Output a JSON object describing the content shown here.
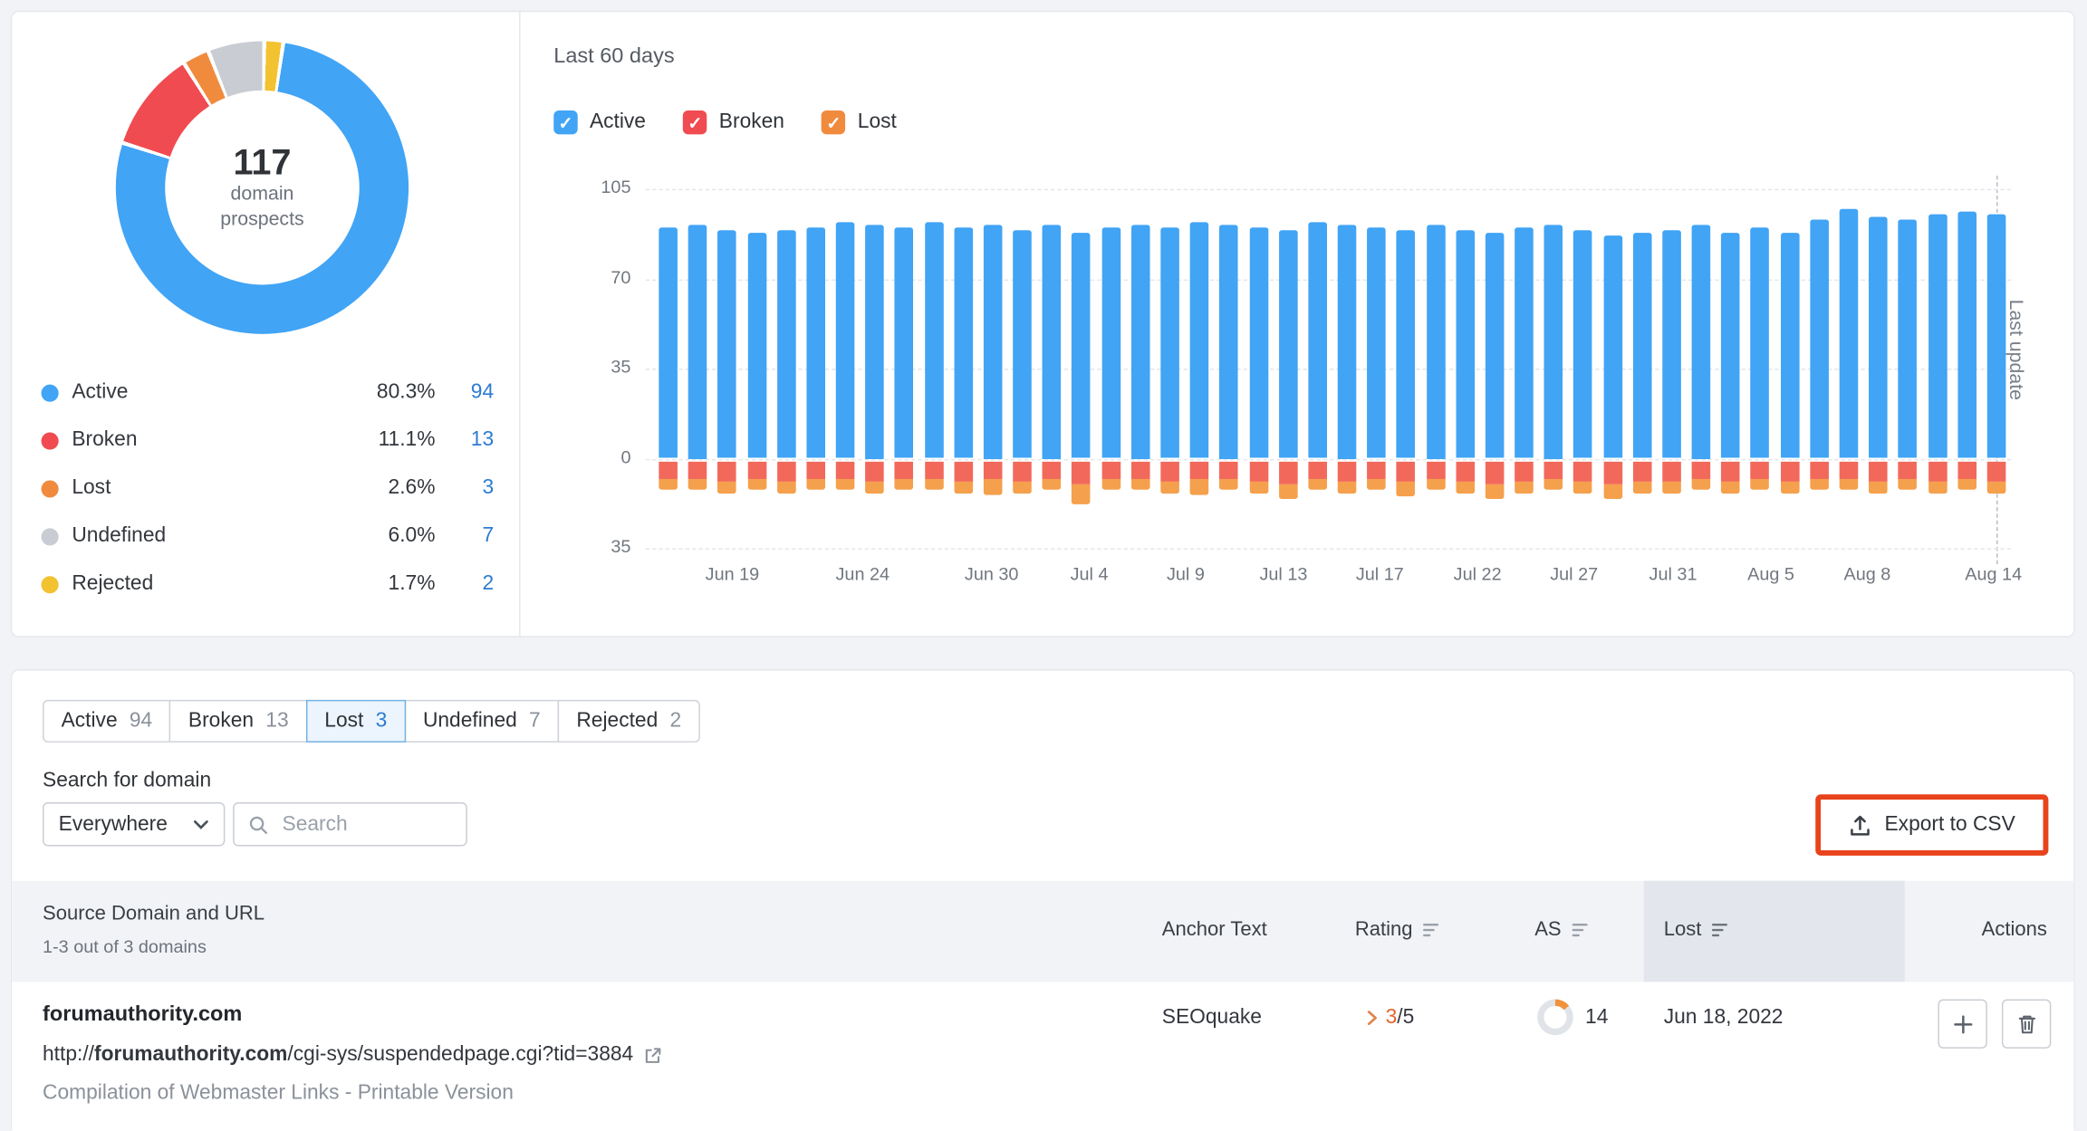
{
  "donut": {
    "center_value": "117",
    "center_line1": "domain",
    "center_line2": "prospects",
    "legend": [
      {
        "label": "Active",
        "percent": "80.3%",
        "count": "94",
        "color": "#41a4f5"
      },
      {
        "label": "Broken",
        "percent": "11.1%",
        "count": "13",
        "color": "#f04b50"
      },
      {
        "label": "Lost",
        "percent": "2.6%",
        "count": "3",
        "color": "#f08b3e"
      },
      {
        "label": "Undefined",
        "percent": "6.0%",
        "count": "7",
        "color": "#c9ccd2"
      },
      {
        "label": "Rejected",
        "percent": "1.7%",
        "count": "2",
        "color": "#f2c230"
      }
    ]
  },
  "timeline": {
    "title": "Last 60 days",
    "filters": [
      {
        "label": "Active",
        "color": "#41a4f5"
      },
      {
        "label": "Broken",
        "color": "#f04b50"
      },
      {
        "label": "Lost",
        "color": "#f08b3e"
      }
    ],
    "last_update_label": "Last update"
  },
  "chart_data": {
    "type": "bar",
    "stacked": true,
    "title": "Last 60 days",
    "ylim": [
      -35,
      105
    ],
    "grid": true,
    "yticks": [
      {
        "value": 105,
        "label": "105"
      },
      {
        "value": 70,
        "label": "70"
      },
      {
        "value": 35,
        "label": "35"
      },
      {
        "value": 0,
        "label": "0"
      },
      {
        "value": -35,
        "label": "35"
      }
    ],
    "series": [
      {
        "name": "Active",
        "color": "#41a4f5",
        "direction": "positive",
        "values": [
          90,
          91,
          89,
          88,
          89,
          90,
          92,
          91,
          90,
          92,
          90,
          91,
          89,
          91,
          88,
          90,
          91,
          90,
          92,
          91,
          90,
          89,
          92,
          91,
          90,
          89,
          91,
          89,
          88,
          90,
          91,
          89,
          87,
          88,
          89,
          91,
          88,
          90,
          88,
          93,
          97,
          94,
          93,
          95,
          96,
          95
        ]
      },
      {
        "name": "Broken",
        "color": "#f2695c",
        "direction": "negative",
        "values": [
          7,
          7,
          8,
          7,
          8,
          7,
          7,
          8,
          7,
          7,
          8,
          7,
          8,
          7,
          9,
          7,
          7,
          8,
          7,
          7,
          8,
          9,
          7,
          8,
          7,
          8,
          7,
          8,
          9,
          8,
          7,
          8,
          9,
          8,
          8,
          7,
          8,
          7,
          8,
          7,
          7,
          8,
          7,
          8,
          7,
          8
        ]
      },
      {
        "name": "Lost",
        "color": "#f5a04c",
        "direction": "negative",
        "values": [
          4,
          4,
          5,
          4,
          5,
          4,
          4,
          5,
          4,
          4,
          5,
          6,
          5,
          4,
          8,
          4,
          4,
          5,
          6,
          4,
          5,
          6,
          4,
          5,
          4,
          6,
          4,
          5,
          6,
          5,
          4,
          5,
          6,
          5,
          5,
          4,
          5,
          4,
          5,
          4,
          4,
          5,
          4,
          5,
          4,
          5
        ]
      }
    ],
    "x_ticks": [
      {
        "label": "Jun 19",
        "pos": 0.058
      },
      {
        "label": "Jun 24",
        "pos": 0.154
      },
      {
        "label": "Jun 30",
        "pos": 0.249
      },
      {
        "label": "Jul 4",
        "pos": 0.321
      },
      {
        "label": "Jul 9",
        "pos": 0.392
      },
      {
        "label": "Jul 13",
        "pos": 0.464
      },
      {
        "label": "Jul 17",
        "pos": 0.535
      },
      {
        "label": "Jul 22",
        "pos": 0.607
      },
      {
        "label": "Jul 27",
        "pos": 0.678
      },
      {
        "label": "Jul 31",
        "pos": 0.751
      },
      {
        "label": "Aug 5",
        "pos": 0.823
      },
      {
        "label": "Aug 8",
        "pos": 0.894
      },
      {
        "label": "Aug 14",
        "pos": 0.987
      }
    ],
    "last_update_index": 45
  },
  "tabs": [
    {
      "label": "Active",
      "count": "94",
      "selected": false
    },
    {
      "label": "Broken",
      "count": "13",
      "selected": false
    },
    {
      "label": "Lost",
      "count": "3",
      "selected": true
    },
    {
      "label": "Undefined",
      "count": "7",
      "selected": false
    },
    {
      "label": "Rejected",
      "count": "2",
      "selected": false
    }
  ],
  "search": {
    "label": "Search for domain",
    "scope": "Everywhere",
    "placeholder": "Search"
  },
  "export": {
    "label": "Export to CSV"
  },
  "table": {
    "headers": {
      "source": "Source Domain and URL",
      "source_sub": "1-3 out of 3 domains",
      "anchor": "Anchor Text",
      "rating": "Rating",
      "as": "AS",
      "lost": "Lost",
      "actions": "Actions"
    },
    "row": {
      "domain": "forumauthority.com",
      "url_prefix": "http://",
      "url_domain": "forumauthority.com",
      "url_path": "/cgi-sys/suspendedpage.cgi?tid=3884",
      "page_title": "Compilation of Webmaster Links - Printable Version",
      "anchor": "SEOquake",
      "rating_value": "3",
      "rating_max": "/5",
      "as_value": "14",
      "lost_date": "Jun 18, 2022"
    }
  },
  "colors": {
    "accent_blue": "#41a4f5",
    "link_blue": "#2d7cd1",
    "annotation_red": "#e8431c",
    "rating_orange": "#e8622d"
  }
}
